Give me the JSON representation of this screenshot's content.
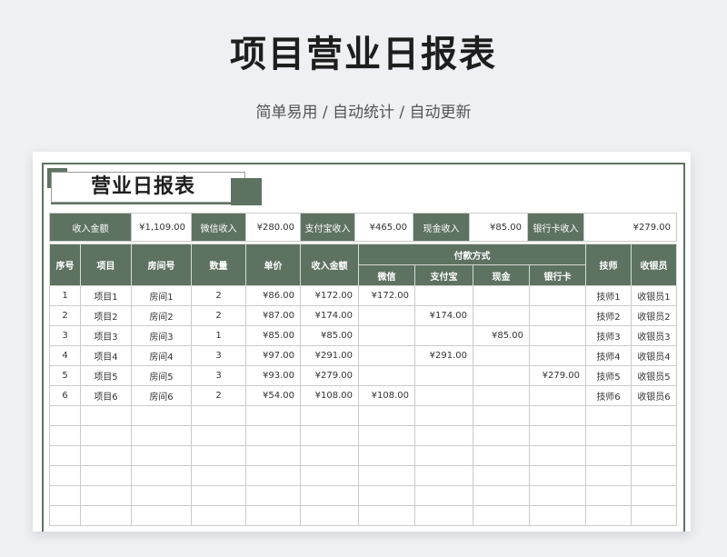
{
  "page": {
    "title": "项目营业日报表",
    "subtitle": "简单易用 / 自动统计 / 自动更新"
  },
  "sheet": {
    "title": "营业日报表"
  },
  "summary": [
    {
      "label": "收入金额",
      "value": "¥1,109.00"
    },
    {
      "label": "微信收入",
      "value": "¥280.00"
    },
    {
      "label": "支付宝收入",
      "value": "¥465.00"
    },
    {
      "label": "现金收入",
      "value": "¥85.00"
    },
    {
      "label": "银行卡收入",
      "value": "¥279.00"
    }
  ],
  "table": {
    "headers": {
      "seq": "序号",
      "item": "项目",
      "room": "房间号",
      "qty": "数量",
      "price": "单价",
      "income": "收入金额",
      "payment_group": "付款方式",
      "wechat": "微信",
      "alipay": "支付宝",
      "cash": "现金",
      "bank": "银行卡",
      "tech": "技师",
      "cashier": "收银员"
    },
    "rows": [
      [
        "1",
        "项目1",
        "房间1",
        "2",
        "¥86.00",
        "¥172.00",
        "¥172.00",
        "",
        "",
        "",
        "技师1",
        "收银员1"
      ],
      [
        "2",
        "项目2",
        "房间2",
        "2",
        "¥87.00",
        "¥174.00",
        "",
        "¥174.00",
        "",
        "",
        "技师2",
        "收银员2"
      ],
      [
        "3",
        "项目3",
        "房间3",
        "1",
        "¥85.00",
        "¥85.00",
        "",
        "",
        "¥85.00",
        "",
        "技师3",
        "收银员3"
      ],
      [
        "4",
        "项目4",
        "房间4",
        "3",
        "¥97.00",
        "¥291.00",
        "",
        "¥291.00",
        "",
        "",
        "技师4",
        "收银员4"
      ],
      [
        "5",
        "项目5",
        "房间5",
        "3",
        "¥93.00",
        "¥279.00",
        "",
        "",
        "",
        "¥279.00",
        "技师5",
        "收银员5"
      ],
      [
        "6",
        "项目6",
        "房间6",
        "2",
        "¥54.00",
        "¥108.00",
        "¥108.00",
        "",
        "",
        "",
        "技师6",
        "收银员6"
      ]
    ],
    "empty_rows": 6
  },
  "colors": {
    "header_bg": "#5e7262",
    "page_bg": "#eef0f3",
    "grid_line": "#c9ccc9"
  }
}
